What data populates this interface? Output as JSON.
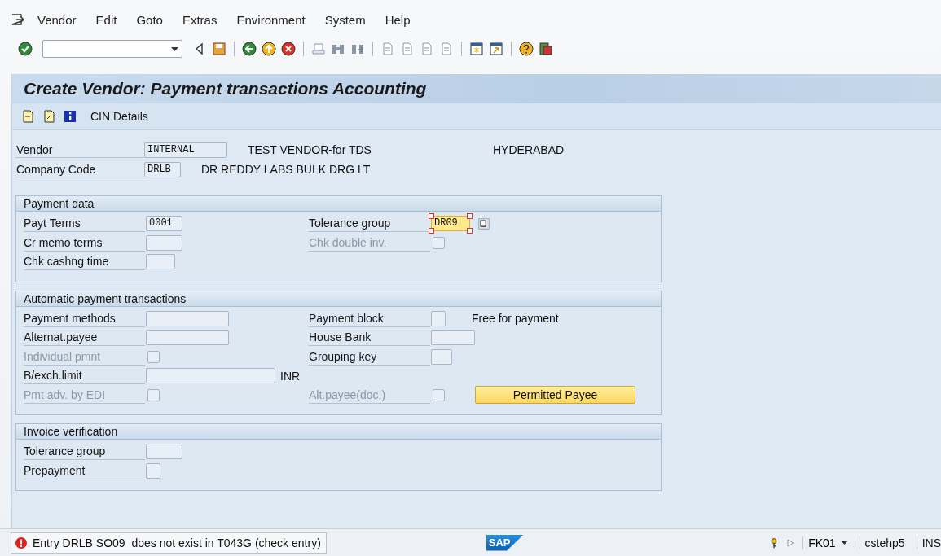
{
  "menu": [
    {
      "label": "Vendor"
    },
    {
      "label": "Edit"
    },
    {
      "label": "Goto"
    },
    {
      "label": "Extras"
    },
    {
      "label": "Environment"
    },
    {
      "label": "System"
    },
    {
      "label": "Help"
    }
  ],
  "title": "Create Vendor: Payment transactions Accounting",
  "app_toolbar": {
    "button": "CIN Details"
  },
  "header": [
    {
      "label": "Vendor",
      "value": "INTERNAL",
      "text": "TEST VENDOR-for TDS",
      "extra": "HYDERABAD"
    },
    {
      "label": "Company Code",
      "value": "DRLB",
      "text": "DR REDDY LABS BULK DRG LT"
    }
  ],
  "groups": [
    {
      "title": "Payment data",
      "rows": [
        {
          "cells": [
            {
              "label": "Payt Terms",
              "disabled": false,
              "kind": "input",
              "value": "0001",
              "highlighted": false
            },
            {
              "label": "Tolerance group",
              "disabled": false,
              "kind": "input",
              "value": "DR09",
              "highlighted": true
            }
          ]
        },
        {
          "cells": [
            {
              "label": "Cr memo terms",
              "disabled": false,
              "kind": "input",
              "highlighted": false
            },
            {
              "label": "Chk double inv.",
              "disabled": true,
              "kind": "checkbox",
              "checked": false
            }
          ]
        },
        {
          "cells": [
            {
              "label": "Chk cashng time",
              "disabled": false,
              "kind": "input",
              "highlighted": false
            }
          ]
        }
      ]
    },
    {
      "title": "Automatic payment transactions",
      "rows": [
        {
          "cells": [
            {
              "label": "Payment methods",
              "disabled": false,
              "kind": "input",
              "highlighted": false
            },
            {
              "label": "Payment block",
              "disabled": false,
              "kind": "input",
              "highlighted": false,
              "note": "Free for payment"
            }
          ]
        },
        {
          "cells": [
            {
              "label": "Alternat.payee",
              "disabled": false,
              "kind": "input",
              "highlighted": false
            },
            {
              "label": "House Bank",
              "disabled": false,
              "kind": "input",
              "highlighted": false
            }
          ]
        },
        {
          "cells": [
            {
              "label": "Individual pmnt",
              "disabled": true,
              "kind": "checkbox",
              "checked": false
            },
            {
              "label": "Grouping key",
              "disabled": false,
              "kind": "input",
              "highlighted": false
            }
          ]
        },
        {
          "cells": [
            {
              "label": "B/exch.limit",
              "disabled": false,
              "kind": "input",
              "highlighted": false,
              "note": "INR"
            }
          ]
        },
        {
          "cells": [
            {
              "label": "Pmt adv. by EDI",
              "disabled": true,
              "kind": "checkbox",
              "checked": false
            },
            {
              "label": "Alt.payee(doc.)",
              "disabled": true,
              "kind": "checkbox",
              "checked": false,
              "button": "Permitted Payee"
            }
          ]
        }
      ]
    },
    {
      "title": "Invoice verification",
      "rows": [
        {
          "cells": [
            {
              "label": "Tolerance group",
              "disabled": false,
              "kind": "input",
              "highlighted": false
            }
          ]
        },
        {
          "cells": [
            {
              "label": "Prepayment",
              "disabled": false,
              "kind": "input",
              "highlighted": false
            }
          ]
        }
      ]
    }
  ],
  "status_bar": {
    "message": {
      "kind": "error",
      "text": "Entry DRLB SO09  does not exist in T043G (check entry)"
    },
    "logo": "SAP",
    "transaction": "FK01",
    "server": "cstehp5",
    "mode": "INS"
  }
}
